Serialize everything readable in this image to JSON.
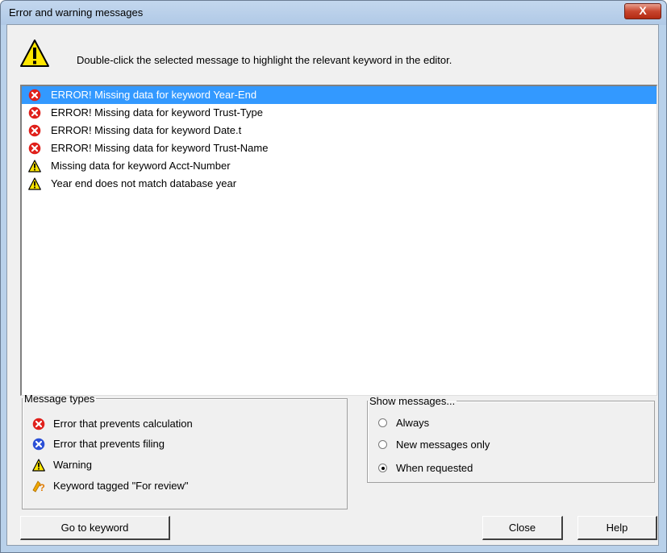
{
  "window": {
    "title": "Error and warning messages",
    "close_glyph": "X"
  },
  "instruction": "Double-click the selected message to highlight the relevant keyword in the editor.",
  "messages": [
    {
      "icon": "error-icon",
      "text": "ERROR! Missing data for keyword Year-End",
      "selected": true
    },
    {
      "icon": "error-icon",
      "text": "ERROR! Missing data for keyword Trust-Type"
    },
    {
      "icon": "error-icon",
      "text": "ERROR! Missing data for keyword Date.t"
    },
    {
      "icon": "error-icon",
      "text": "ERROR! Missing data for keyword Trust-Name"
    },
    {
      "icon": "warning-icon",
      "text": "Missing data for keyword Acct-Number"
    },
    {
      "icon": "warning-icon",
      "text": "Year end does not match database year"
    }
  ],
  "message_types": {
    "legend": "Message types",
    "items": [
      {
        "icon": "error-icon",
        "label": "Error that prevents calculation"
      },
      {
        "icon": "filing-error-icon",
        "label": "Error that prevents filing"
      },
      {
        "icon": "warning-icon",
        "label": "Warning"
      },
      {
        "icon": "review-tag-icon",
        "label": "Keyword tagged \"For review\""
      }
    ]
  },
  "show_messages": {
    "legend": "Show messages...",
    "options": [
      {
        "label": "Always",
        "checked": false
      },
      {
        "label": "New messages only",
        "checked": false
      },
      {
        "label": "When requested",
        "checked": true
      }
    ]
  },
  "buttons": {
    "go_to_keyword": "Go to keyword",
    "close": "Close",
    "help": "Help"
  },
  "colors": {
    "selection": "#3399ff",
    "error_red": "#e0201b",
    "filing_blue": "#2a4fd6",
    "warning_yellow": "#ffe600"
  }
}
